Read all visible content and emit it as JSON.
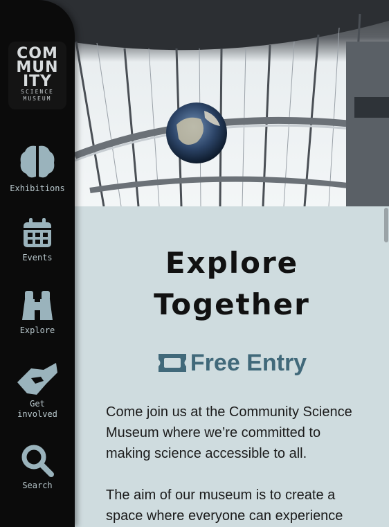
{
  "logo": {
    "line1": "COM",
    "line2": "MUN",
    "line3": "ITY",
    "line4": "SCIENCE",
    "line5": "MUSEUM"
  },
  "nav": [
    {
      "label": "Exhibitions",
      "icon": "brain-icon"
    },
    {
      "label": "Events",
      "icon": "calendar-icon"
    },
    {
      "label": "Explore",
      "icon": "binoculars-icon"
    },
    {
      "label": "Get\ninvolved",
      "icon": "handshake-icon"
    },
    {
      "label": "Search",
      "icon": "search-icon"
    }
  ],
  "main": {
    "title_line1": "Explore",
    "title_line2": "Together",
    "free_entry": "Free Entry",
    "para1": "Come join us at the Community Science Museum where we’re committed to making science accessible to all.",
    "para2": "The aim of our museum is to create a space where everyone can experience"
  },
  "colors": {
    "sidebar": "#0b0b0b",
    "accent": "#41697a",
    "icon": "#9ab3bc",
    "background": "#cfdcdf"
  }
}
